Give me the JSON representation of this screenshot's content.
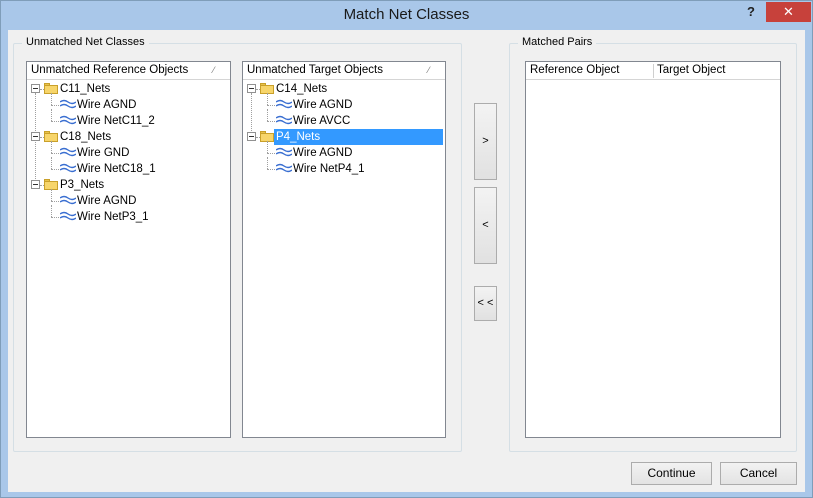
{
  "window": {
    "title": "Match Net Classes",
    "help_label": "?",
    "close_label": "✕"
  },
  "unmatched": {
    "group_label": "Unmatched Net Classes",
    "reference": {
      "header": "Unmatched Reference Objects",
      "items": [
        {
          "label": "C11_Nets",
          "type": "class"
        },
        {
          "label": "Wire AGND",
          "type": "net"
        },
        {
          "label": "Wire NetC11_2",
          "type": "net"
        },
        {
          "label": "C18_Nets",
          "type": "class"
        },
        {
          "label": "Wire GND",
          "type": "net"
        },
        {
          "label": "Wire NetC18_1",
          "type": "net"
        },
        {
          "label": "P3_Nets",
          "type": "class"
        },
        {
          "label": "Wire AGND",
          "type": "net"
        },
        {
          "label": "Wire NetP3_1",
          "type": "net"
        }
      ]
    },
    "target": {
      "header": "Unmatched Target Objects",
      "items": [
        {
          "label": "C14_Nets",
          "type": "class"
        },
        {
          "label": "Wire AGND",
          "type": "net"
        },
        {
          "label": "Wire AVCC",
          "type": "net"
        },
        {
          "label": "P4_Nets",
          "type": "class",
          "selected": true
        },
        {
          "label": "Wire AGND",
          "type": "net"
        },
        {
          "label": "Wire NetP4_1",
          "type": "net"
        }
      ]
    }
  },
  "buttons": {
    "add": ">",
    "remove": "<",
    "remove_all": "< <"
  },
  "matched": {
    "group_label": "Matched Pairs",
    "columns": [
      "Reference Object",
      "Target Object"
    ]
  },
  "footer": {
    "continue_label": "Continue",
    "cancel_label": "Cancel"
  },
  "colors": {
    "selection": "#3399ff",
    "frame": "#a9c7e9",
    "close": "#c7413b"
  }
}
